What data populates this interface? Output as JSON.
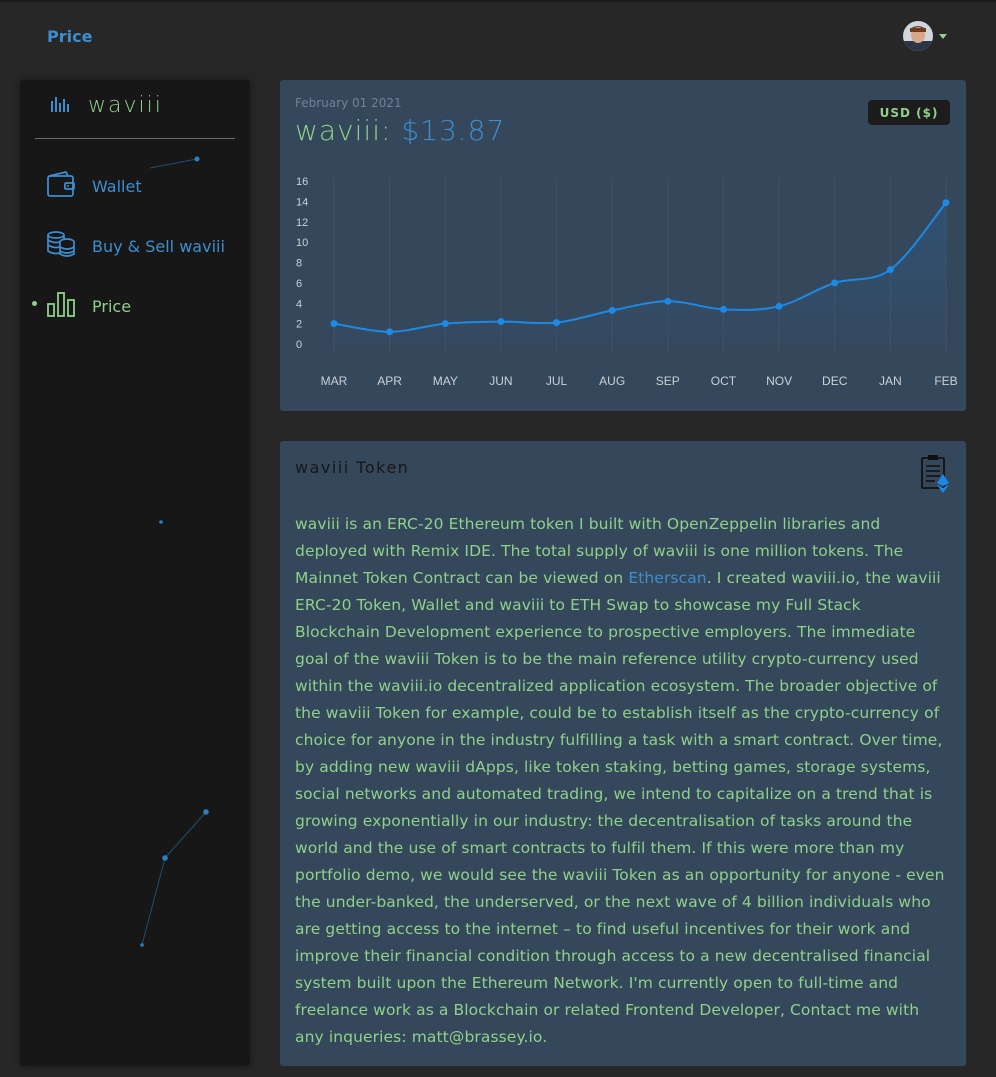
{
  "header": {
    "title": "Price"
  },
  "sidebar": {
    "brand": "waviii",
    "items": [
      {
        "label": "Wallet",
        "icon": "wallet-icon"
      },
      {
        "label": "Buy & Sell waviii",
        "icon": "coins-icon"
      },
      {
        "label": "Price",
        "icon": "bar-chart-icon"
      }
    ]
  },
  "price_card": {
    "date": "February 01 2021",
    "token": "waviii:",
    "price": "$13.87",
    "currency": "USD ($)"
  },
  "chart_data": {
    "type": "area",
    "categories": [
      "MAR",
      "APR",
      "MAY",
      "JUN",
      "JUL",
      "AUG",
      "SEP",
      "OCT",
      "NOV",
      "DEC",
      "JAN",
      "FEB"
    ],
    "values": [
      2.0,
      1.2,
      2.0,
      2.2,
      2.1,
      3.3,
      4.2,
      3.4,
      3.7,
      6.0,
      7.3,
      13.87
    ],
    "yticks": [
      0,
      2,
      4,
      6,
      8,
      10,
      12,
      14,
      16
    ],
    "ylim": [
      0,
      16
    ],
    "grid": true,
    "colors": {
      "line": "#1e88e5",
      "fill": "#2a5d8f"
    }
  },
  "token_card": {
    "title": "waviii Token",
    "icon": "contract-ethereum-icon",
    "para_1": "waviii is an ERC-20 Ethereum token I built with OpenZeppelin libraries and deployed with Remix IDE. The total supply of waviii is one million tokens. The Mainnet Token Contract can be viewed on ",
    "link": "Etherscan",
    "para_2": ". I created waviii.io, the waviii ERC-20 Token, Wallet and waviii to ETH Swap to showcase my Full Stack Blockchain Development experience to prospective employers. The immediate goal of the waviii Token is to be the main reference utility crypto-currency used within the waviii.io decentralized application ecosystem. The broader objective of the waviii Token for example, could be to establish itself as the crypto-currency of choice for anyone in the industry fulfilling a task with a smart contract. Over time, by adding new waviii dApps, like token staking, betting games, storage systems, social networks and automated trading, we intend to capitalize on a trend that is growing exponentially in our industry: the decentralisation of tasks around the world and the use of smart contracts to fulfil them. If this were more than my portfolio demo, we would see the waviii Token as an opportunity for anyone - even the under-banked, the underserved, or the next wave of 4 billion individuals who are getting access to the internet – to find useful incentives for their work and improve their financial condition through access to a new decentralised financial system built upon the Ethereum Network. I'm currently open to full-time and freelance work as a Blockchain or related Frontend Developer, Contact me with any inqueries: matt@brassey.io."
  },
  "colors": {
    "green": "#8fd18a",
    "blue": "#3c8ed0",
    "card": "#35475a",
    "sidebar": "#171717"
  }
}
